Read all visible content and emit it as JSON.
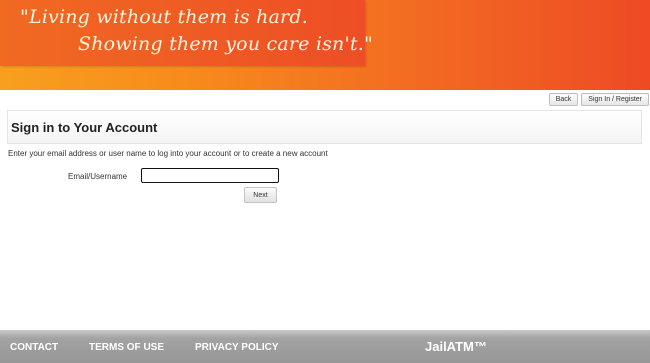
{
  "banner": {
    "quote_line1": "\"Living without them is hard.",
    "quote_line2": "Showing them you care isn't.\""
  },
  "top_nav": {
    "back_label": "Back",
    "sign_in_label": "Sign In / Register"
  },
  "page": {
    "heading": "Sign in to Your Account",
    "instructions": "Enter your email address or user name to log into your account or to create a new account"
  },
  "form": {
    "email_label": "Email/Username",
    "email_value": "",
    "next_label": "Next"
  },
  "footer": {
    "links": [
      "CONTACT",
      "TERMS OF USE",
      "PRIVACY POLICY"
    ],
    "brand": "JailATM™"
  }
}
